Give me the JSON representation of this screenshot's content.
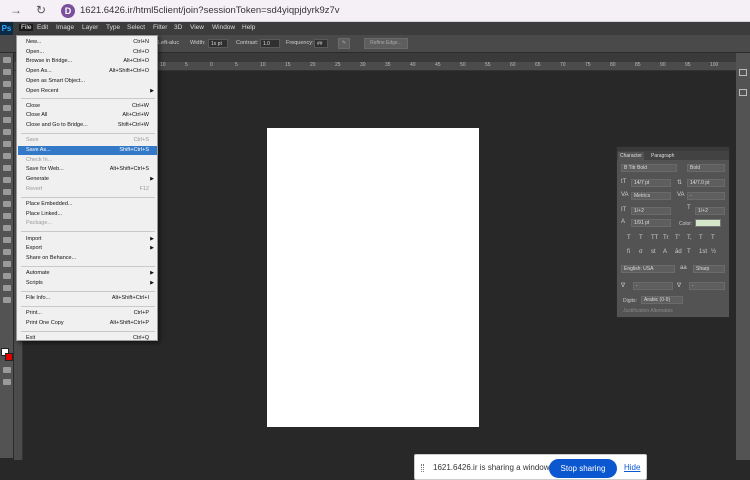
{
  "browser": {
    "url": "1621.6426.ir/html5client/join?sessionToken=sd4yiqpjdyrk9z7v",
    "favicon_letter": "D"
  },
  "menubar": {
    "items": [
      "File",
      "Edit",
      "Image",
      "Layer",
      "Type",
      "Select",
      "Filter",
      "3D",
      "View",
      "Window",
      "Help"
    ]
  },
  "options_bar": {
    "left_label": "Left-aluc",
    "width_label": "Width:",
    "width_value": "1x pt",
    "contrast_label": "Contrast:",
    "contrast_value": "1.0",
    "frequency_label": "Frequency:",
    "frequency_value": "##",
    "refine_button": "Refine Edge..."
  },
  "file_menu": {
    "items": [
      {
        "label": "New...",
        "shortcut": "Ctrl+N"
      },
      {
        "label": "Open...",
        "shortcut": "Ctrl+O"
      },
      {
        "label": "Browse in Bridge...",
        "shortcut": "Alt+Ctrl+O"
      },
      {
        "label": "Open As...",
        "shortcut": "Alt+Shift+Ctrl+O"
      },
      {
        "label": "Open as Smart Object...",
        "shortcut": ""
      },
      {
        "label": "Open Recent",
        "shortcut": "",
        "submenu": true
      },
      {
        "label": "Close",
        "shortcut": "Ctrl+W"
      },
      {
        "label": "Close All",
        "shortcut": "Alt+Ctrl+W"
      },
      {
        "label": "Close and Go to Bridge...",
        "shortcut": "Shift+Ctrl+W"
      },
      {
        "label": "Save",
        "shortcut": "Ctrl+S",
        "disabled": true
      },
      {
        "label": "Save As...",
        "shortcut": "Shift+Ctrl+S",
        "highlight": true
      },
      {
        "label": "Check In...",
        "shortcut": "",
        "disabled": true
      },
      {
        "label": "Save for Web...",
        "shortcut": "Alt+Shift+Ctrl+S"
      },
      {
        "label": "Generate",
        "shortcut": "",
        "submenu": true
      },
      {
        "label": "Revert",
        "shortcut": "F12",
        "disabled": true
      },
      {
        "label": "Place Embedded...",
        "shortcut": ""
      },
      {
        "label": "Place Linked...",
        "shortcut": ""
      },
      {
        "label": "Package...",
        "shortcut": "",
        "disabled": true
      },
      {
        "label": "Import",
        "shortcut": "",
        "submenu": true
      },
      {
        "label": "Export",
        "shortcut": "",
        "submenu": true
      },
      {
        "label": "Share on Behance...",
        "shortcut": ""
      },
      {
        "label": "Automate",
        "shortcut": "",
        "submenu": true
      },
      {
        "label": "Scripts",
        "shortcut": "",
        "submenu": true
      },
      {
        "label": "File Info...",
        "shortcut": "Alt+Shift+Ctrl+I"
      },
      {
        "label": "Print...",
        "shortcut": "Ctrl+P"
      },
      {
        "label": "Print One Copy",
        "shortcut": "Alt+Shift+Ctrl+P"
      },
      {
        "label": "Exit",
        "shortcut": "Ctrl+Q"
      }
    ]
  },
  "character_panel": {
    "tab_character": "Character",
    "tab_paragraph": "Paragraph",
    "font_family": "B Titr Bold",
    "font_style": "Bold",
    "font_size": "14/7 pt",
    "leading": "14/7.0 pt",
    "kerning": "Metrics",
    "tracking": "-",
    "vertical_scale": "1/+2",
    "horizontal_scale": "1/+2",
    "baseline_shift": "1/91 pt",
    "color_label": "Color:",
    "color_value": "#d4e8c9",
    "type_buttons": [
      "T",
      "T",
      "TT",
      "Tr",
      "T'",
      "T,",
      "T",
      "T"
    ],
    "opentype_buttons": [
      "fi",
      "σ",
      "st",
      "A",
      "ād",
      "T",
      "1st",
      "½"
    ],
    "language": "English: USA",
    "antialias": "Sharp",
    "lang_small1": "-",
    "lang_small2": "-",
    "digits_label": "Digits:",
    "digits_value": "Arabic (0-9)",
    "ordinal_label": "Justification Alternates"
  },
  "ruler_ticks": [
    "10",
    "5",
    "0",
    "5",
    "10",
    "15",
    "20",
    "25",
    "30",
    "35",
    "40",
    "45",
    "50",
    "55",
    "60",
    "65",
    "70",
    "75",
    "80",
    "85",
    "90",
    "95",
    "100"
  ],
  "share_bar": {
    "message": "1621.6426.ir is sharing a window.",
    "stop_label": "Stop sharing",
    "hide_label": "Hide"
  },
  "colors": {
    "foreground": "#ffffff",
    "background": "#e00000",
    "menu_highlight": "#3479c8",
    "share_button": "#0b57d0"
  }
}
